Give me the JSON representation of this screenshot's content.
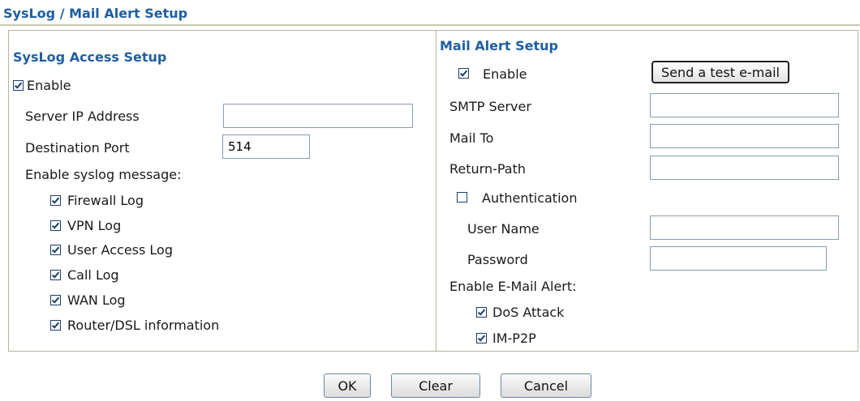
{
  "page": {
    "title": "SysLog / Mail Alert Setup"
  },
  "syslog": {
    "title": "SysLog Access Setup",
    "enable_label": "Enable",
    "enable_checked": true,
    "server_ip_label": "Server IP Address",
    "server_ip_value": "",
    "dest_port_label": "Destination Port",
    "dest_port_value": "514",
    "messages_label": "Enable syslog message:",
    "messages": [
      {
        "label": "Firewall Log",
        "checked": true
      },
      {
        "label": "VPN Log",
        "checked": true
      },
      {
        "label": "User Access Log",
        "checked": true
      },
      {
        "label": "Call Log",
        "checked": true
      },
      {
        "label": "WAN Log",
        "checked": true
      },
      {
        "label": "Router/DSL information",
        "checked": true
      }
    ]
  },
  "mail": {
    "title": "Mail Alert Setup",
    "enable_label": "Enable",
    "enable_checked": true,
    "test_button": "Send a test e-mail",
    "smtp_label": "SMTP Server",
    "smtp_value": "",
    "mailto_label": "Mail To",
    "mailto_value": "",
    "return_path_label": "Return-Path",
    "return_path_value": "",
    "auth_label": "Authentication",
    "auth_checked": false,
    "username_label": "User Name",
    "username_value": "",
    "password_label": "Password",
    "password_value": "",
    "alerts_label": "Enable E-Mail Alert:",
    "alerts": [
      {
        "label": "DoS Attack",
        "checked": true
      },
      {
        "label": "IM-P2P",
        "checked": true
      }
    ]
  },
  "buttons": {
    "ok": "OK",
    "clear": "Clear",
    "cancel": "Cancel"
  },
  "colors": {
    "accent": "#1f5fa0",
    "border": "#b6b59c",
    "check": "#1c3f6b"
  }
}
